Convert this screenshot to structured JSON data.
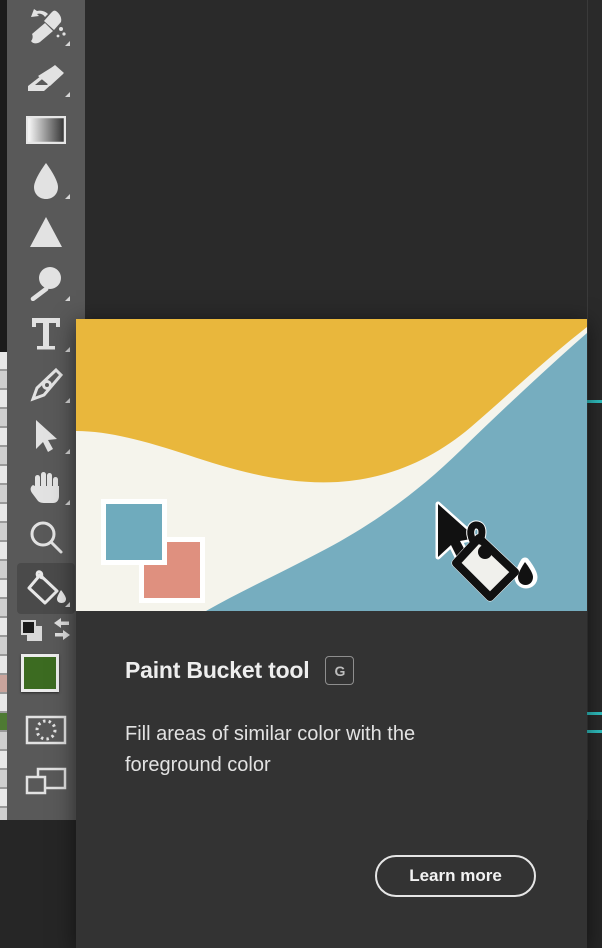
{
  "app": {
    "background_color": "#2a2a2a",
    "toolbar_color": "#595959"
  },
  "toolbar": {
    "name": "Tools panel",
    "tools": [
      {
        "id": "mixer-brush",
        "label": "Mixer Brush tool",
        "icon": "brush-icon",
        "has_flyout": true,
        "selected": false
      },
      {
        "id": "eraser",
        "label": "Eraser tool",
        "icon": "eraser-icon",
        "has_flyout": true,
        "selected": false
      },
      {
        "id": "gradient",
        "label": "Gradient tool",
        "icon": "gradient-icon",
        "has_flyout": false,
        "selected": false
      },
      {
        "id": "blur",
        "label": "Blur tool",
        "icon": "droplet-icon",
        "has_flyout": true,
        "selected": false
      },
      {
        "id": "dodge",
        "label": "Dodge tool",
        "icon": "triangle-icon",
        "has_flyout": false,
        "selected": false
      },
      {
        "id": "burn",
        "label": "Burn tool",
        "icon": "magnifier-solid-icon",
        "has_flyout": true,
        "selected": false
      },
      {
        "id": "type",
        "label": "Horizontal Type tool",
        "icon": "type-t-icon",
        "has_flyout": true,
        "selected": false
      },
      {
        "id": "pen",
        "label": "Pen tool",
        "icon": "pen-nib-icon",
        "has_flyout": true,
        "selected": false
      },
      {
        "id": "path-select",
        "label": "Path Selection tool",
        "icon": "arrow-pointer-icon",
        "has_flyout": true,
        "selected": false
      },
      {
        "id": "hand",
        "label": "Hand tool",
        "icon": "hand-icon",
        "has_flyout": true,
        "selected": false
      },
      {
        "id": "zoom",
        "label": "Zoom tool",
        "icon": "magnifier-icon",
        "has_flyout": false,
        "selected": false
      },
      {
        "id": "paint-bucket",
        "label": "Paint Bucket tool",
        "icon": "paint-bucket-icon",
        "has_flyout": true,
        "selected": true
      }
    ],
    "color_controls": {
      "default_colors_label": "Default Foreground and Background Colors",
      "swap_colors_label": "Switch Foreground and Background Colors",
      "foreground_color": "#3c6b21",
      "background_color": "#ffffff"
    },
    "quick_mask_label": "Edit in Quick Mask Mode",
    "screen_mode_label": "Change Screen Mode"
  },
  "popup": {
    "name": "Tool tip coach mark",
    "title": "Paint Bucket tool",
    "shortcut": "G",
    "description": "Fill areas of similar color with the foreground color",
    "learn_more_label": "Learn more",
    "illustration": {
      "name": "paint-bucket-demo-illustration",
      "colors": {
        "top_fill": "#e9b73c",
        "band_fill": "#f5f4ec",
        "bottom_fill": "#76adbf",
        "swatch_blue": "#6fabbd",
        "swatch_salmon": "#df907f"
      },
      "cursor": "arrow-pointer-with-paint-bucket"
    }
  },
  "accents": {
    "teal": "#2fc0c0",
    "blue_line": "#2f7fd4"
  }
}
